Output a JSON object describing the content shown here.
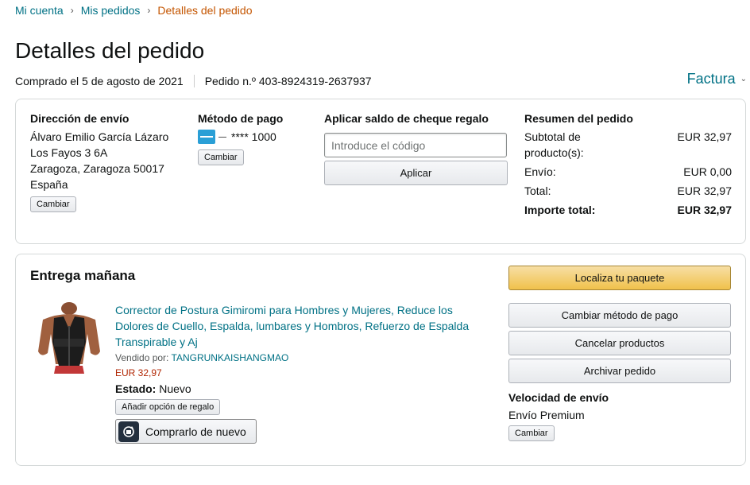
{
  "breadcrumb": {
    "items": [
      "Mi cuenta",
      "Mis pedidos",
      "Detalles del pedido"
    ],
    "separator": "›"
  },
  "page": {
    "title": "Detalles del pedido",
    "purchased": "Comprado el 5 de agosto de 2021",
    "order_number": "Pedido n.º 403-8924319-2637937",
    "invoice_label": "Factura"
  },
  "shipping": {
    "title": "Dirección de envío",
    "name": "Álvaro Emilio García Lázaro",
    "street": "Los Fayos 3 6A",
    "city": "Zaragoza, Zaragoza 50017",
    "country": "España",
    "change_label": "Cambiar"
  },
  "payment": {
    "title": "Método de pago",
    "card": "**** 1000",
    "change_label": "Cambiar"
  },
  "gift_card": {
    "title": "Aplicar saldo de cheque regalo",
    "placeholder": "Introduce el código",
    "apply_label": "Aplicar"
  },
  "summary": {
    "title": "Resumen del pedido",
    "rows": [
      {
        "label": "Subtotal de producto(s):",
        "value": "EUR 32,97"
      },
      {
        "label": "Envío:",
        "value": "EUR 0,00"
      },
      {
        "label": "Total:",
        "value": "EUR 32,97"
      }
    ],
    "grand_total_label": "Importe total:",
    "grand_total_value": "EUR 32,97"
  },
  "delivery": {
    "title": "Entrega mañana",
    "product": {
      "title": "Corrector de Postura Gimiromi para Hombres y Mujeres, Reduce los Dolores de Cuello, Espalda, lumbares y Hombros, Refuerzo de Espalda Transpirable y Aj",
      "sold_by_label": "Vendido por:",
      "seller": "TANGRUNKAISHANGMAO",
      "price": "EUR 32,97",
      "condition_label": "Estado:",
      "condition_value": "Nuevo",
      "gift_option_label": "Añadir opción de regalo",
      "buy_again_label": "Comprarlo de nuevo"
    },
    "actions": {
      "track": "Localiza tu paquete",
      "change_payment": "Cambiar método de pago",
      "cancel": "Cancelar productos",
      "archive": "Archivar pedido"
    },
    "speed_title": "Velocidad de envío",
    "speed_value": "Envío Premium",
    "speed_change_label": "Cambiar"
  },
  "colors": {
    "link": "#007185",
    "current_crumb": "#c45500",
    "price": "#b12704",
    "primary_button": "#f0c14b"
  }
}
